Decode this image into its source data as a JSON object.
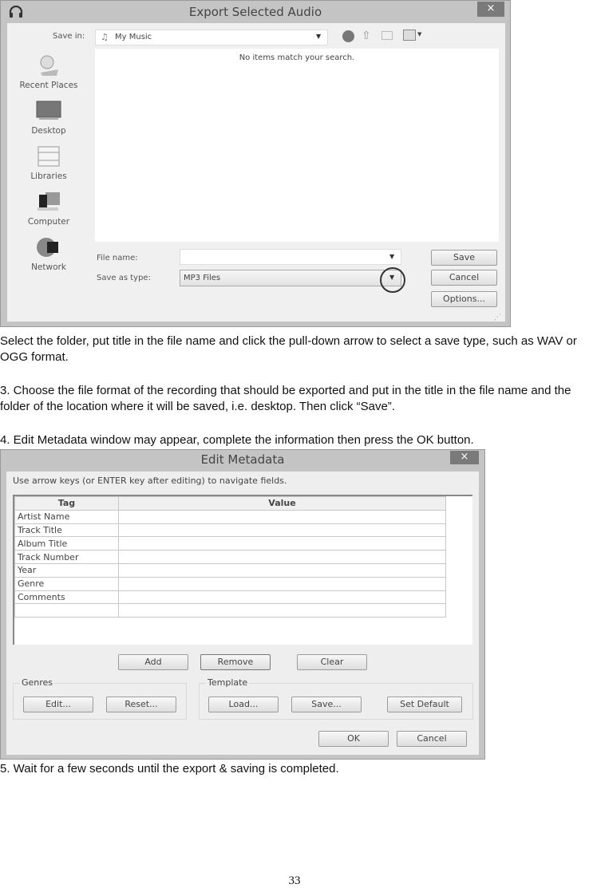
{
  "export_dialog": {
    "title": "Export Selected Audio",
    "close_label": "×",
    "save_in_label": "Save in:",
    "save_in_value": "My Music",
    "empty_message": "No items match your search.",
    "places": [
      {
        "label": "Recent Places",
        "icon": "recent-places-icon"
      },
      {
        "label": "Desktop",
        "icon": "desktop-icon"
      },
      {
        "label": "Libraries",
        "icon": "libraries-icon"
      },
      {
        "label": "Computer",
        "icon": "computer-icon"
      },
      {
        "label": "Network",
        "icon": "network-icon"
      }
    ],
    "file_name_label": "File name:",
    "file_name_value": "",
    "save_as_type_label": "Save as type:",
    "save_as_type_value": "MP3 Files",
    "buttons": {
      "save": "Save",
      "cancel": "Cancel",
      "options": "Options..."
    }
  },
  "instructions": {
    "p1": "Select the folder, put title in the file name and click the pull-down arrow to select a save type, such as WAV or OGG format.",
    "p2": "3. Choose the file format of the recording that should be exported and put in the title in the file name and the folder of the location where it will be saved, i.e. desktop. Then click “Save”.",
    "p3": "4. Edit Metadata window may appear, complete the information then press the OK button.",
    "p4": "5. Wait for a few seconds until the export & saving is completed."
  },
  "metadata_dialog": {
    "title": "Edit Metadata",
    "close_label": "×",
    "hint": "Use arrow keys (or ENTER key after editing) to navigate fields.",
    "columns": [
      "Tag",
      "Value"
    ],
    "rows": [
      {
        "tag": "Artist Name",
        "value": ""
      },
      {
        "tag": "Track Title",
        "value": ""
      },
      {
        "tag": "Album Title",
        "value": ""
      },
      {
        "tag": "Track Number",
        "value": ""
      },
      {
        "tag": "Year",
        "value": ""
      },
      {
        "tag": "Genre",
        "value": ""
      },
      {
        "tag": "Comments",
        "value": ""
      },
      {
        "tag": "",
        "value": ""
      }
    ],
    "buttons": {
      "add": "Add",
      "remove": "Remove",
      "clear": "Clear",
      "ok": "OK",
      "cancel": "Cancel"
    },
    "genres": {
      "title": "Genres",
      "edit": "Edit...",
      "reset": "Reset..."
    },
    "template": {
      "title": "Template",
      "load": "Load...",
      "save": "Save...",
      "set_default": "Set Default"
    }
  },
  "page_number": "33"
}
